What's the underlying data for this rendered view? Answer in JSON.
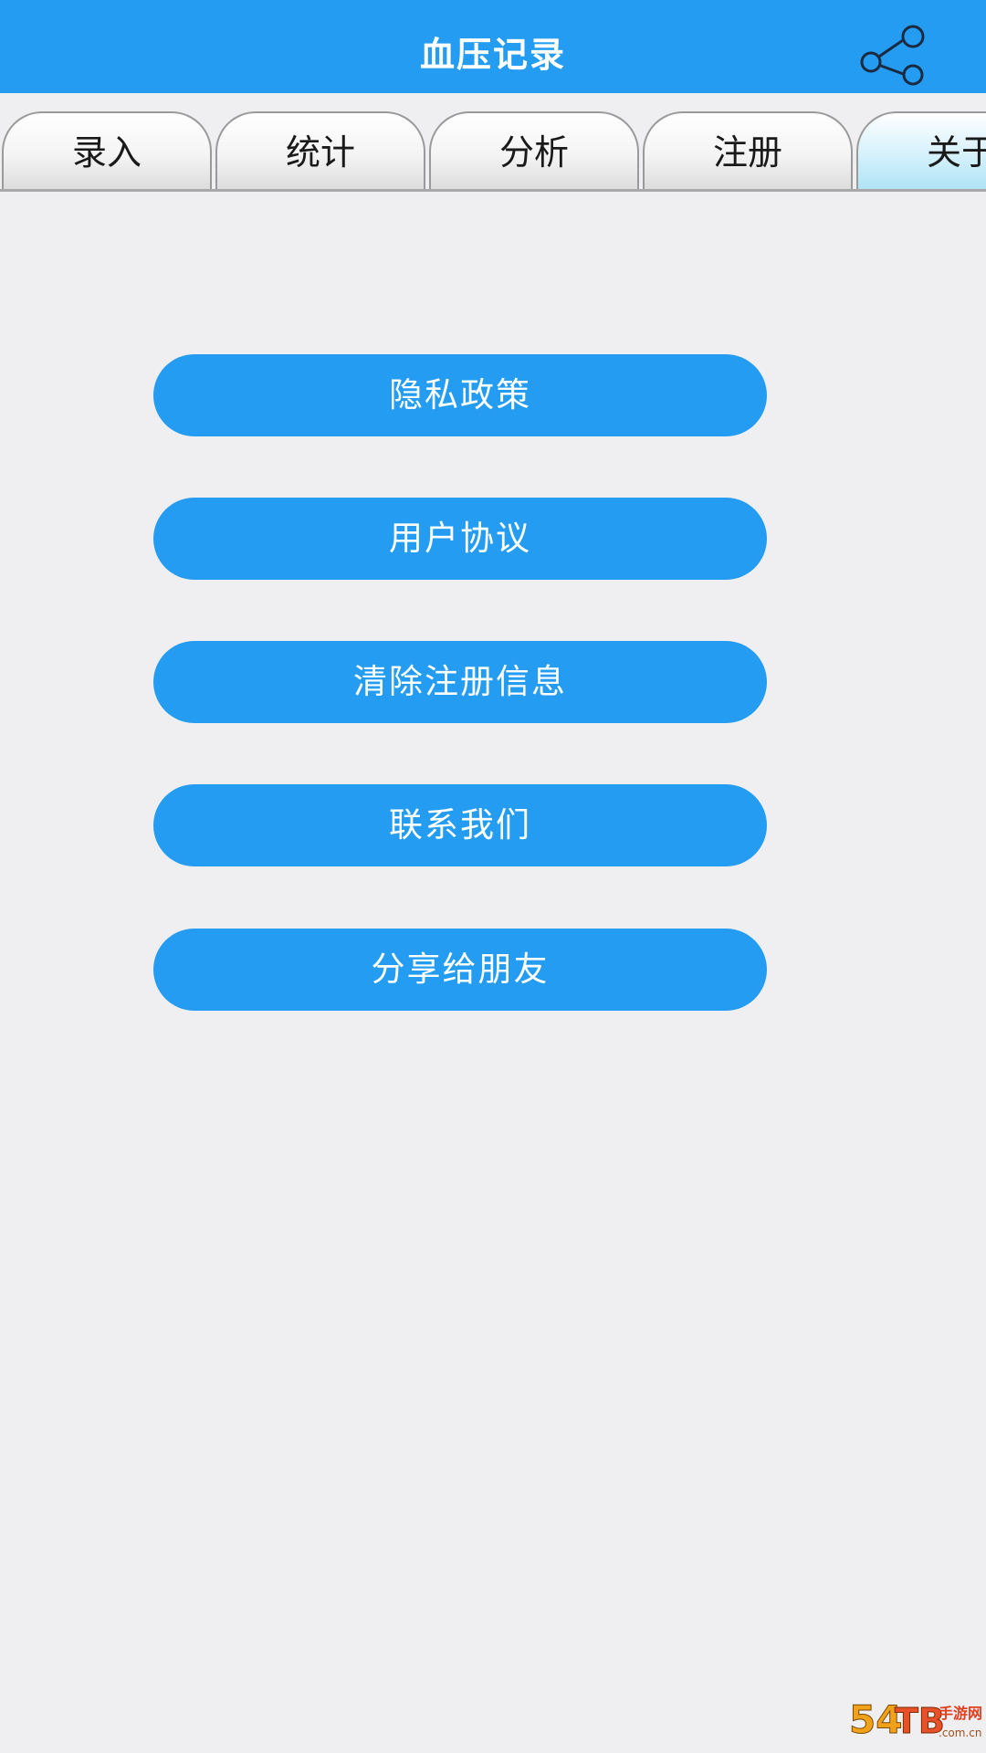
{
  "header": {
    "title": "血压记录",
    "share_icon": "share-icon"
  },
  "tabs": [
    {
      "label": "录入",
      "active": false
    },
    {
      "label": "统计",
      "active": false
    },
    {
      "label": "分析",
      "active": false
    },
    {
      "label": "注册",
      "active": false
    },
    {
      "label": "关于",
      "active": true
    }
  ],
  "menu": [
    {
      "label": "隐私政策"
    },
    {
      "label": "用户协议"
    },
    {
      "label": "清除注册信息"
    },
    {
      "label": "联系我们"
    },
    {
      "label": "分享给朋友"
    }
  ],
  "colors": {
    "primary": "#239cf1",
    "background": "#efeff1",
    "active_tab": "#aee3f6"
  },
  "watermark": {
    "text": "54TB 手游网 .com.cn"
  }
}
